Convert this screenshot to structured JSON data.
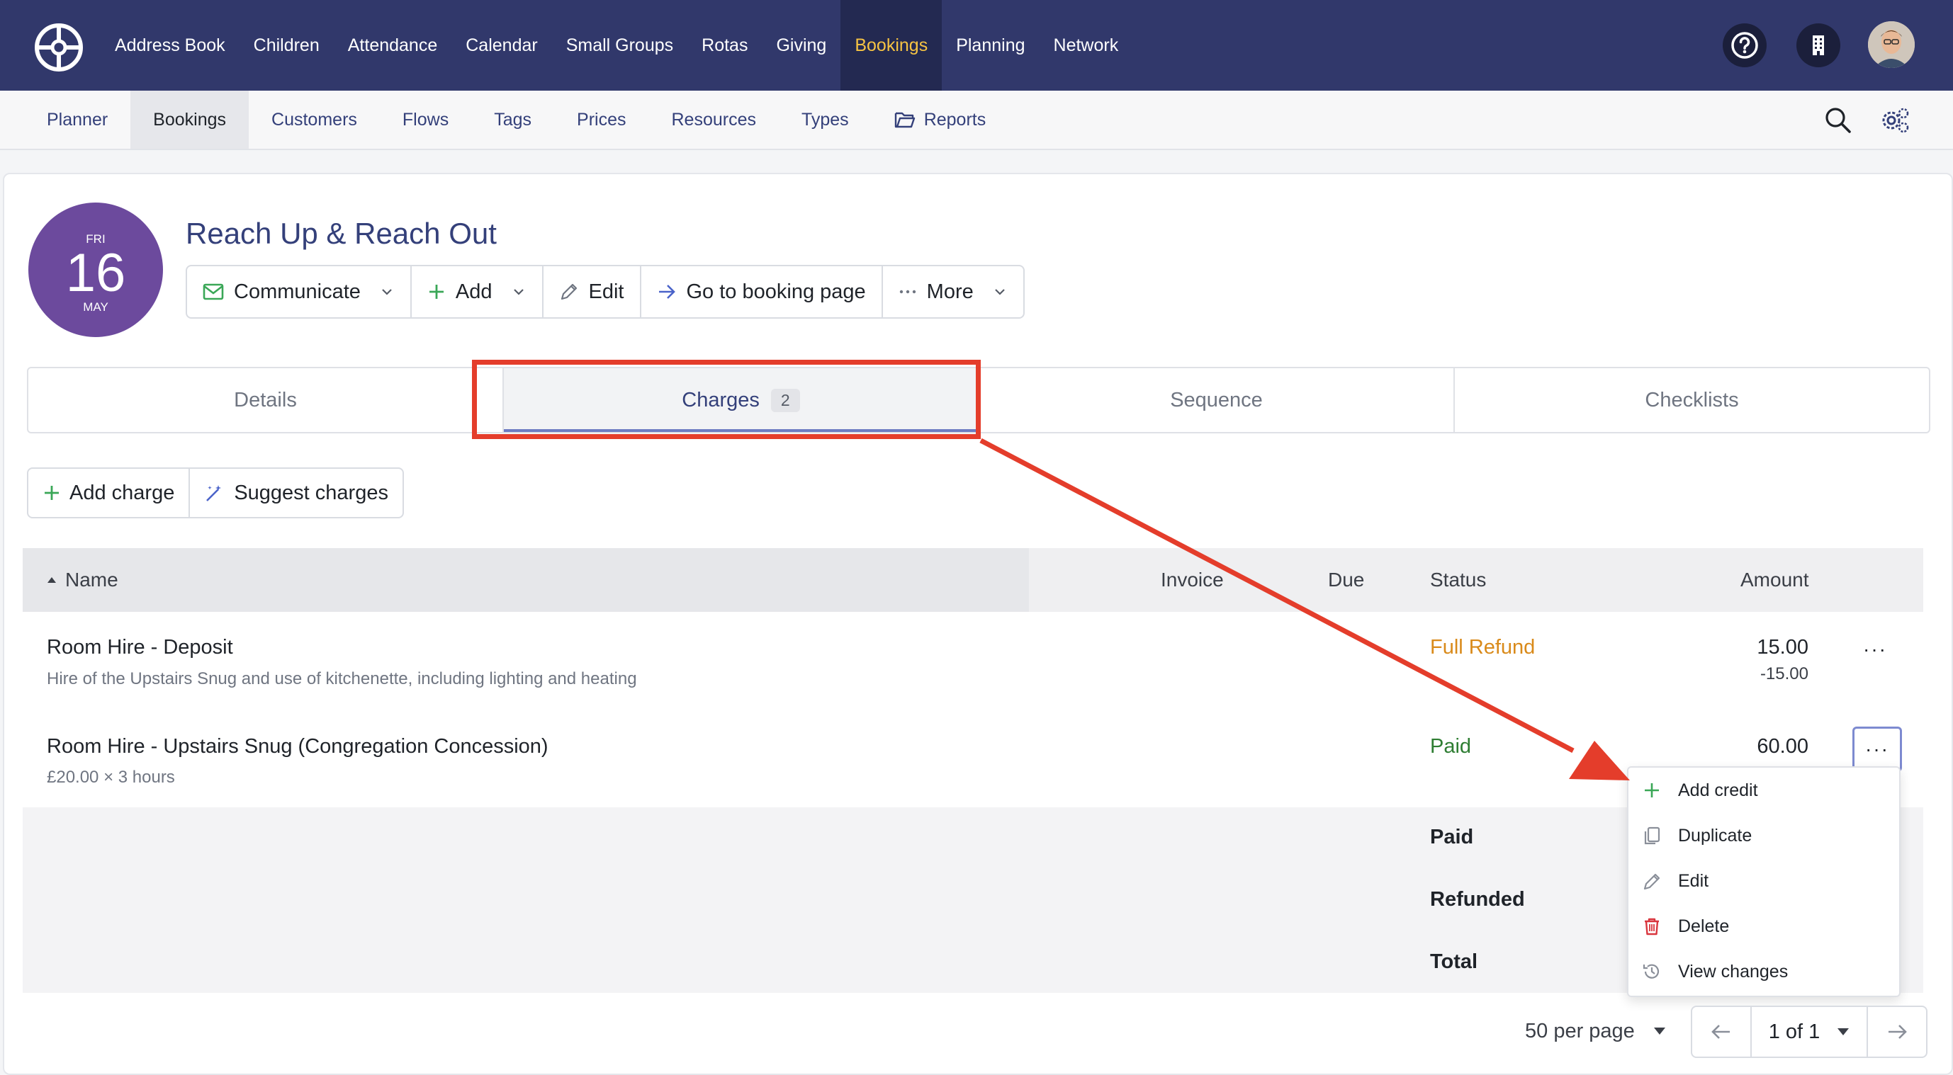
{
  "topnav": {
    "items": [
      "Address Book",
      "Children",
      "Attendance",
      "Calendar",
      "Small Groups",
      "Rotas",
      "Giving",
      "Bookings",
      "Planning",
      "Network"
    ],
    "active_index": 7
  },
  "subnav": {
    "items": [
      "Planner",
      "Bookings",
      "Customers",
      "Flows",
      "Tags",
      "Prices",
      "Resources",
      "Types",
      "Reports"
    ],
    "active_index": 1
  },
  "booking": {
    "date": {
      "dow": "FRI",
      "day": "16",
      "month": "MAY"
    },
    "title": "Reach Up & Reach Out",
    "actions": {
      "communicate": "Communicate",
      "add": "Add",
      "edit": "Edit",
      "go_to_booking_page": "Go to booking page",
      "more": "More"
    }
  },
  "tabs": {
    "details": "Details",
    "charges": "Charges",
    "charges_count": "2",
    "sequence": "Sequence",
    "checklists": "Checklists"
  },
  "charge_actions": {
    "add_charge": "Add charge",
    "suggest_charges": "Suggest charges"
  },
  "table": {
    "headers": {
      "name": "Name",
      "invoice": "Invoice",
      "due": "Due",
      "status": "Status",
      "amount": "Amount"
    },
    "rows": [
      {
        "title": "Room Hire - Deposit",
        "description": "Hire of the Upstairs Snug and use of kitchenette, including lighting and heating",
        "status": "Full Refund",
        "amount": "15.00",
        "amount_sub": "-15.00",
        "menu": "···"
      },
      {
        "title": "Room Hire - Upstairs Snug (Congregation Concession)",
        "description": "£20.00 × 3 hours",
        "status": "Paid",
        "amount": "60.00",
        "menu": "···"
      }
    ],
    "summary": {
      "paid": "Paid",
      "refunded": "Refunded",
      "total": "Total"
    }
  },
  "row_menu": {
    "add_credit": "Add credit",
    "duplicate": "Duplicate",
    "edit": "Edit",
    "delete": "Delete",
    "view_changes": "View changes"
  },
  "pagination": {
    "per_page": "50 per page",
    "page": "1 of 1"
  },
  "colors": {
    "nav_bg": "#31386b",
    "nav_active": "#f6c343",
    "link": "#34407a",
    "date_badge": "#6c4a9d",
    "status_refund": "#d98a1a",
    "status_paid": "#2e7d32",
    "annotation": "#e43d2b",
    "add_green": "#3aa757",
    "delete_red": "#d9363e"
  }
}
